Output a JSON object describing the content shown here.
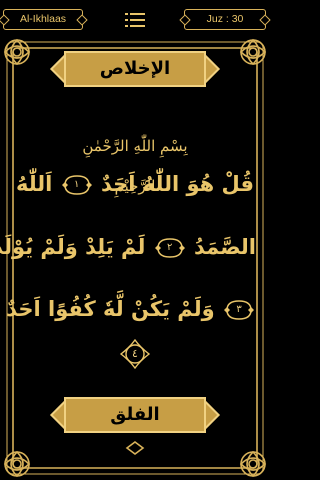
{
  "header": {
    "surah_name": "Al-Ikhlaas",
    "juz_label": "Juz : 30",
    "menu_icon": "list-icon"
  },
  "surah": {
    "title": "الإخلاص",
    "basmala": "بِسْمِ اللّٰهِ الرَّحْمٰنِ الرَّحِيْمِ",
    "lines": [
      {
        "segments": [
          "قُلْ هُوَ اللّٰهُ اَحَدٌ",
          "١",
          "اَللّٰهُ"
        ]
      },
      {
        "segments": [
          "الصَّمَدُ",
          "٢",
          "لَمْ يَلِدْ وَلَمْ يُوْلَدْ"
        ]
      },
      {
        "segments": [
          "٣",
          "وَلَمْ يَكُنْ لَّهٗ كُفُوًا اَحَدٌ"
        ]
      }
    ],
    "end_marker": "٤"
  },
  "next_surah": {
    "title": "الفلق"
  },
  "colors": {
    "gold": "#e9c56a",
    "banner_fill": "#c79e45",
    "background": "#000000"
  }
}
